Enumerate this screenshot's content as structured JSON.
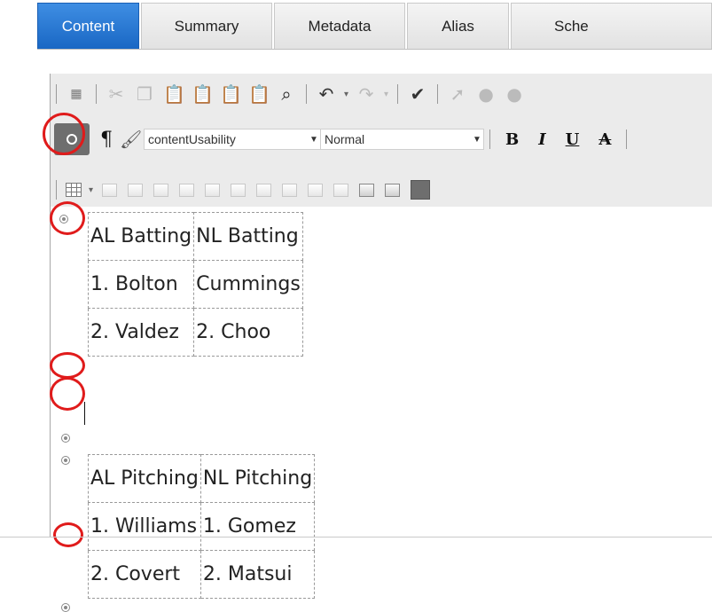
{
  "tabs": [
    {
      "label": "Content",
      "active": true
    },
    {
      "label": "Summary",
      "active": false
    },
    {
      "label": "Metadata",
      "active": false
    },
    {
      "label": "Alias",
      "active": false
    },
    {
      "label": "Sche",
      "active": false
    }
  ],
  "toolbar": {
    "style_select": "contentUsability",
    "format_select": "Normal",
    "bold_label": "B",
    "italic_label": "I",
    "underline_label": "U",
    "strike_label": "A",
    "pilcrow": "¶"
  },
  "colors": {
    "active_tab": "#1967c4",
    "annotation_circle": "#e01b1b",
    "selected_button": "#6e6e6e"
  },
  "tables": [
    {
      "rows": [
        [
          "AL Batting",
          "NL Batting"
        ],
        [
          "1. Bolton",
          "Cummings"
        ],
        [
          "2. Valdez",
          "2. Choo"
        ]
      ]
    },
    {
      "rows": [
        [
          "AL Pitching",
          "NL Pitching"
        ],
        [
          "1. Williams",
          "1. Gomez"
        ],
        [
          "2. Covert",
          "2. Matsui"
        ]
      ]
    }
  ]
}
